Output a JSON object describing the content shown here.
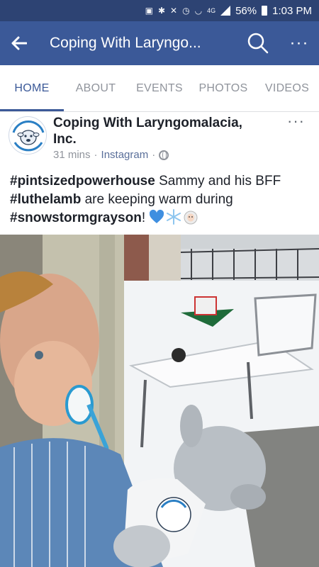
{
  "status_bar": {
    "network": "4G",
    "battery": "56%",
    "time": "1:03 PM"
  },
  "app_bar": {
    "title": "Coping With Laryngo...",
    "back_icon": "back-arrow-icon",
    "search_icon": "search-icon",
    "more_icon": "more-icon"
  },
  "tabs": [
    {
      "label": "HOME",
      "active": true
    },
    {
      "label": "ABOUT",
      "active": false
    },
    {
      "label": "EVENTS",
      "active": false
    },
    {
      "label": "PHOTOS",
      "active": false
    },
    {
      "label": "VIDEOS",
      "active": false
    }
  ],
  "post": {
    "page_name": "Coping With Laryngomalacia, Inc.",
    "time_ago": "31 mins",
    "separator": "·",
    "source": "Instagram",
    "privacy_icon": "globe-icon",
    "text": {
      "tag1": "#pintsizedpowerhouse",
      "part1": " Sammy and his BFF ",
      "tag2": "#luthelamb",
      "part2": " are keeping warm during ",
      "tag3": "#snowstormgrayson",
      "part3": "!",
      "emojis": [
        "blue-heart-icon",
        "snowflake-icon",
        "sheep-icon"
      ]
    },
    "avatar_logo_text": "Coping With Laryngomalacia, Inc.",
    "photo_mitten_text": "Coping With Laryngomalacia #LutheLamb"
  },
  "colors": {
    "facebook_blue": "#3b5998",
    "status_bar": "#2d4373",
    "meta_gray": "#90949c"
  }
}
